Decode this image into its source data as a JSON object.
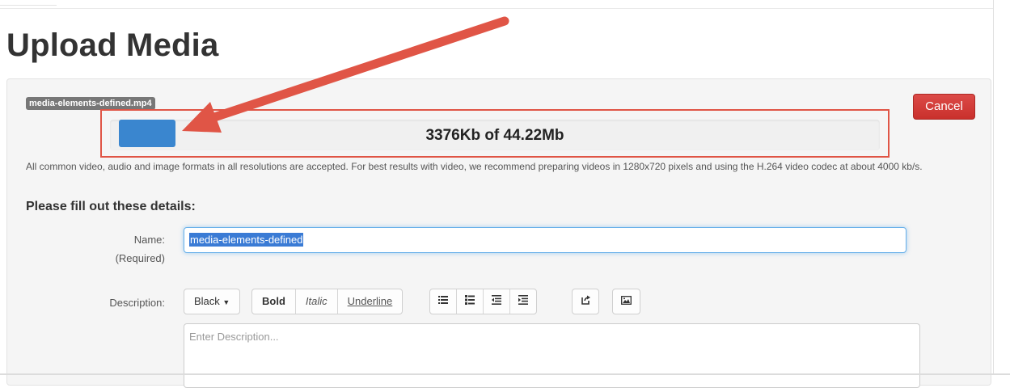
{
  "page": {
    "title": "Upload Media"
  },
  "upload": {
    "file_name": "media-elements-defined.mp4",
    "cancel_label": "Cancel",
    "progress_text": "3376Kb of 44.22Mb",
    "progress_fraction": 0.075,
    "help_text": "All common video, audio and image formats in all resolutions are accepted.  For best results with video, we recommend preparing videos in 1280x720 pixels and using the H.264 video codec at about 4000 kb/s."
  },
  "form": {
    "heading": "Please fill out these details:",
    "name_label": "Name:",
    "name_required": "(Required)",
    "name_value": "media-elements-defined",
    "description_label": "Description:",
    "description_placeholder": "Enter Description..."
  },
  "toolbar": {
    "color_label": "Black",
    "bold_label": "Bold",
    "italic_label": "Italic",
    "underline_label": "Underline",
    "icons": [
      "unordered-list-icon",
      "ordered-list-icon",
      "outdent-icon",
      "indent-icon",
      "link-icon",
      "image-icon"
    ]
  },
  "colors": {
    "accent": "#3a86cf",
    "cancel": "#d2312e",
    "annotation": "#e05546"
  }
}
